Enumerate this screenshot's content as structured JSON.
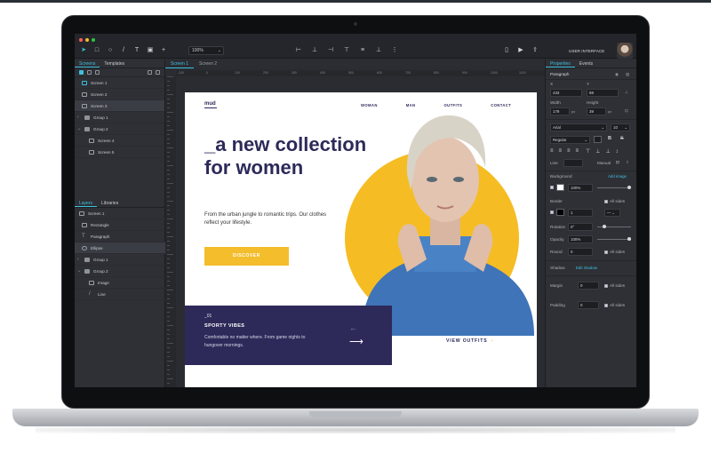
{
  "toolbar": {
    "zoom": "100%",
    "ui_label": "USER INTERFACE",
    "window_dots": [
      "#ff5f57",
      "#febc2e",
      "#28c840"
    ]
  },
  "left_panel": {
    "tabs": [
      "Screens",
      "Templates"
    ],
    "screens": [
      {
        "label": "Screen 1",
        "selected": false
      },
      {
        "label": "Screen 2",
        "selected": false
      },
      {
        "label": "Screen 3",
        "selected": true
      },
      {
        "label": "Group 1",
        "selected": false
      },
      {
        "label": "Group 2",
        "selected": false
      },
      {
        "label": "Screen 4",
        "selected": false
      },
      {
        "label": "Screen 5",
        "selected": false
      }
    ],
    "layer_tabs": [
      "Layers",
      "Libraries"
    ],
    "layers": [
      {
        "label": "Screen 1",
        "icon": "monitor-icon"
      },
      {
        "label": "Rectangle",
        "icon": "rectangle-icon"
      },
      {
        "label": "Paragraph",
        "icon": "text-icon"
      },
      {
        "label": "Ellipse",
        "icon": "ellipse-icon"
      },
      {
        "label": "Group 1",
        "icon": "folder-icon"
      },
      {
        "label": "Group 2",
        "icon": "folder-icon"
      },
      {
        "label": "Image",
        "icon": "image-icon"
      },
      {
        "label": "Line",
        "icon": "line-icon"
      }
    ]
  },
  "canvas": {
    "tabs": [
      "Screen 1",
      "Screen 2"
    ],
    "ruler": [
      "-100",
      "0",
      "100",
      "200",
      "300",
      "400",
      "500",
      "600",
      "700",
      "800",
      "900",
      "1000",
      "1100"
    ]
  },
  "design": {
    "logo": "mud",
    "nav": [
      "WOMAN",
      "MAN",
      "OUTFITS",
      "CONTACT"
    ],
    "headline": "_a new collection for women",
    "subtitle": "From the urban jungle to romantic trips. Our clothes reflect your lifestyle.",
    "cta": "DISCOVER",
    "promo_number": "_01",
    "promo_title": "SPORTY VIBES",
    "promo_text": "Comfortable no matter where. From game nights to hungover mornings.",
    "view_outfits": "VIEW OUTFITS",
    "colors": {
      "navy": "#2d2a5a",
      "yellow": "#f5bd23",
      "sweater": "#3f74b8"
    }
  },
  "right_panel": {
    "tabs": [
      "Properties",
      "Events"
    ],
    "element": "Paragraph",
    "x_label": "X",
    "y_label": "Y",
    "x": "433",
    "y": "98",
    "width_label": "Width",
    "height_label": "Height",
    "width": "179",
    "height": "39",
    "unit": "px",
    "font": "Arial",
    "font_size": "10",
    "font_weight": "Regular",
    "line_label": "Line",
    "manual_label": "Manual",
    "background_label": "Background",
    "add_image": "Add image",
    "background_opacity": "100%",
    "border_label": "Border",
    "border_width": "1",
    "all_sides": "All sides",
    "rotation_label": "Rotation",
    "rotation": "0°",
    "opacity_label": "Opacity",
    "opacity": "100%",
    "round_label": "Round",
    "round": "0",
    "shadow_label": "Shadow",
    "edit_shadow": "Edit shadow",
    "margin_label": "Margin",
    "margin": "0",
    "padding_label": "Padding",
    "padding": "0"
  }
}
